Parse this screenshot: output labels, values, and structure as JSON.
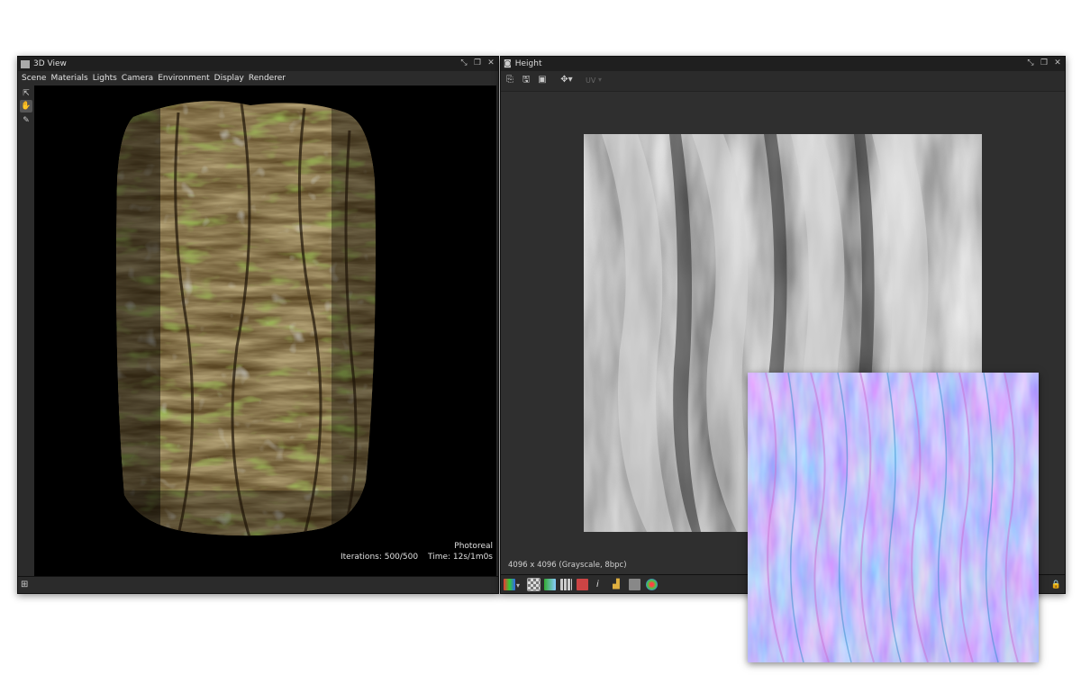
{
  "view3d": {
    "title": "3D View",
    "menu": [
      "Scene",
      "Materials",
      "Lights",
      "Camera",
      "Environment",
      "Display",
      "Renderer"
    ],
    "render_mode": "Photoreal",
    "iterations_label": "Iterations: 500/500",
    "time_label": "Time: 12s/1m0s"
  },
  "height": {
    "title": "Height",
    "uv_label": "UV",
    "image_info": "4096 x 4096 (Grayscale, 8bpc)"
  },
  "colors": {
    "panel_bg": "#2b2b2b",
    "titlebar_bg": "#1f1f1f",
    "viewport_bg": "#000000",
    "normal_map_base": "#7f7fff"
  },
  "icons": {
    "window_pin": "pin-icon",
    "window_float": "float-icon",
    "window_close": "close-icon"
  }
}
